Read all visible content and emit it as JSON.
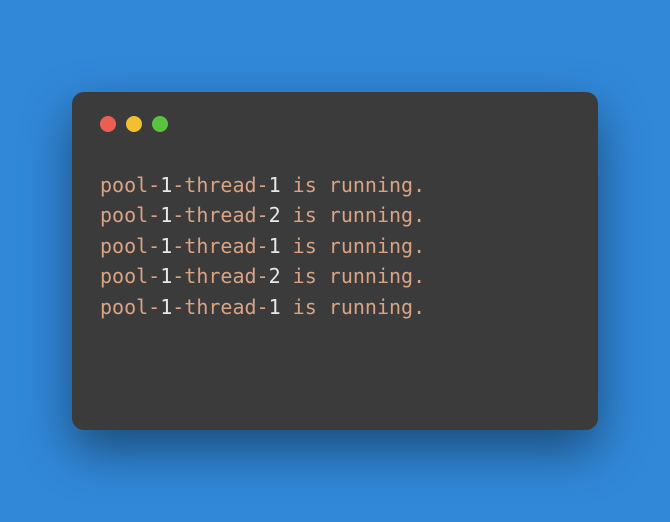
{
  "colors": {
    "bg": "#3188d9",
    "terminal_bg": "#3b3b3b",
    "red": "#ec5e54",
    "yellow": "#f3bf32",
    "green": "#5bc140",
    "text_base": "#d9a384",
    "text_number": "#e8e8e8"
  },
  "traffic_lights": [
    "red",
    "yellow",
    "green"
  ],
  "output": {
    "lines": [
      {
        "tokens": [
          {
            "t": "pool-",
            "c": "base"
          },
          {
            "t": "1",
            "c": "num"
          },
          {
            "t": "-thread-",
            "c": "base"
          },
          {
            "t": "1",
            "c": "num"
          },
          {
            "t": " is running.",
            "c": "base"
          }
        ]
      },
      {
        "tokens": [
          {
            "t": "pool-",
            "c": "base"
          },
          {
            "t": "1",
            "c": "num"
          },
          {
            "t": "-thread-",
            "c": "base"
          },
          {
            "t": "2",
            "c": "num"
          },
          {
            "t": " is running.",
            "c": "base"
          }
        ]
      },
      {
        "tokens": [
          {
            "t": "pool-",
            "c": "base"
          },
          {
            "t": "1",
            "c": "num"
          },
          {
            "t": "-thread-",
            "c": "base"
          },
          {
            "t": "1",
            "c": "num"
          },
          {
            "t": " is running.",
            "c": "base"
          }
        ]
      },
      {
        "tokens": [
          {
            "t": "pool-",
            "c": "base"
          },
          {
            "t": "1",
            "c": "num"
          },
          {
            "t": "-thread-",
            "c": "base"
          },
          {
            "t": "2",
            "c": "num"
          },
          {
            "t": " is running.",
            "c": "base"
          }
        ]
      },
      {
        "tokens": [
          {
            "t": "pool-",
            "c": "base"
          },
          {
            "t": "1",
            "c": "num"
          },
          {
            "t": "-thread-",
            "c": "base"
          },
          {
            "t": "1",
            "c": "num"
          },
          {
            "t": " is running.",
            "c": "base"
          }
        ]
      }
    ]
  }
}
